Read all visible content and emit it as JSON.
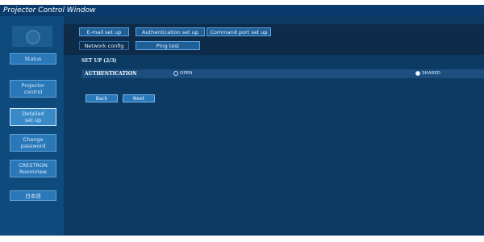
{
  "window": {
    "title": "Projector Control Window"
  },
  "sidebar": {
    "items": [
      {
        "label": "Status"
      },
      {
        "label": "Projector\ncontrol"
      },
      {
        "label": "Detailed\nset up"
      },
      {
        "label": "Change\npassword"
      },
      {
        "label": "CRESTRON\nRoomView"
      },
      {
        "label": "日本語"
      }
    ]
  },
  "tabs": {
    "row1": [
      "E-mail set up",
      "Authentication set up",
      "Command port set up"
    ],
    "row2": [
      "Network config",
      "Ping test"
    ]
  },
  "main": {
    "page_title": "SET UP (2/3)",
    "auth_label": "AUTHENTICATION",
    "options": [
      {
        "label": "OPEN",
        "selected": false
      },
      {
        "label": "SHARED",
        "selected": true
      }
    ],
    "buttons": {
      "back": "Back",
      "next": "Next"
    }
  },
  "colors": {
    "background": "#0b3a63",
    "sidebar": "#0f4a7c",
    "title_bar": "#0a3b6c"
  }
}
